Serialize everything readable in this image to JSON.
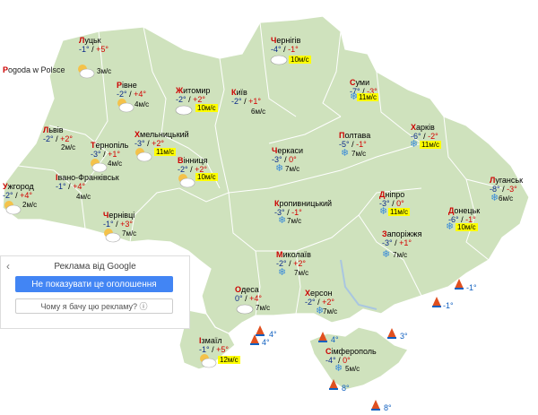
{
  "credit": {
    "first": "P",
    "rest": "ogoda w Polsce"
  },
  "cities": [
    {
      "id": "lutsk",
      "first": "Л",
      "rest": "уцьк",
      "tmin": "-1°",
      "tmax": "+5°",
      "wind": "3м/с",
      "hi": false
    },
    {
      "id": "rivne",
      "first": "Р",
      "rest": "івне",
      "tmin": "-2°",
      "tmax": "+4°",
      "wind": "4м/с",
      "hi": false
    },
    {
      "id": "zhytomyr",
      "first": "Ж",
      "rest": "итомир",
      "tmin": "-2°",
      "tmax": "+2°",
      "wind": "10м/с",
      "hi": true
    },
    {
      "id": "kyiv",
      "first": "К",
      "rest": "иїв",
      "tmin": "-2°",
      "tmax": "+1°",
      "wind": "6м/с",
      "hi": false
    },
    {
      "id": "chernihiv",
      "first": "Ч",
      "rest": "ернігів",
      "tmin": "-4°",
      "tmax": "-1°",
      "wind": "10м/с",
      "hi": true
    },
    {
      "id": "sumy",
      "first": "С",
      "rest": "уми",
      "tmin": "-7°",
      "tmax": "-3°",
      "wind": "11м/с",
      "hi": true
    },
    {
      "id": "lviv",
      "first": "Л",
      "rest": "ьвів",
      "tmin": "-2°",
      "tmax": "+2°",
      "wind": "2м/с",
      "hi": false
    },
    {
      "id": "ternopil",
      "first": "Т",
      "rest": "ернопіль",
      "tmin": "-3°",
      "tmax": "+1°",
      "wind": "4м/с",
      "hi": false
    },
    {
      "id": "khmelnytskyi",
      "first": "Х",
      "rest": "мельницький",
      "tmin": "-3°",
      "tmax": "+2°",
      "wind": "11м/с",
      "hi": true
    },
    {
      "id": "vinnytsia",
      "first": "В",
      "rest": "інниця",
      "tmin": "-2°",
      "tmax": "+2°",
      "wind": "10м/с",
      "hi": true
    },
    {
      "id": "cherkasy",
      "first": "Ч",
      "rest": "еркаси",
      "tmin": "-3°",
      "tmax": "0°",
      "wind": "7м/с",
      "hi": false
    },
    {
      "id": "poltava",
      "first": "П",
      "rest": "олтава",
      "tmin": "-5°",
      "tmax": "-1°",
      "wind": "7м/с",
      "hi": false
    },
    {
      "id": "kharkiv",
      "first": "Х",
      "rest": "арків",
      "tmin": "-6°",
      "tmax": "-2°",
      "wind": "11м/с",
      "hi": true
    },
    {
      "id": "uzhhorod",
      "first": "У",
      "rest": "жгород",
      "tmin": "-2°",
      "tmax": "+4°",
      "wind": "2м/с",
      "hi": false
    },
    {
      "id": "ivano-frankivsk",
      "first": "І",
      "rest": "вано-Франківськ",
      "tmin": "-1°",
      "tmax": "+4°",
      "wind": "4м/с",
      "hi": false
    },
    {
      "id": "chernivtsi",
      "first": "Ч",
      "rest": "ернівці",
      "tmin": "-1°",
      "tmax": "+3°",
      "wind": "7м/с",
      "hi": false
    },
    {
      "id": "kropyvnytskyi",
      "first": "К",
      "rest": "ропивницький",
      "tmin": "-3°",
      "tmax": "-1°",
      "wind": "7м/с",
      "hi": false
    },
    {
      "id": "dnipro",
      "first": "Д",
      "rest": "ніпро",
      "tmin": "-3°",
      "tmax": "0°",
      "wind": "11м/с",
      "hi": true
    },
    {
      "id": "luhansk",
      "first": "Л",
      "rest": "уганськ",
      "tmin": "-8°",
      "tmax": "-3°",
      "wind": "6м/с",
      "hi": false
    },
    {
      "id": "donetsk",
      "first": "Д",
      "rest": "онецьк",
      "tmin": "-6°",
      "tmax": "-1°",
      "wind": "10м/с",
      "hi": true
    },
    {
      "id": "zaporizhzhia",
      "first": "З",
      "rest": "апоріжжя",
      "tmin": "-3°",
      "tmax": "+1°",
      "wind": "7м/с",
      "hi": false
    },
    {
      "id": "mykolaiv",
      "first": "М",
      "rest": "иколаїв",
      "tmin": "-2°",
      "tmax": "+2°",
      "wind": "7м/с",
      "hi": false
    },
    {
      "id": "odesa",
      "first": "О",
      "rest": "деса",
      "tmin": "0°",
      "tmax": "+4°",
      "wind": "7м/с",
      "hi": false
    },
    {
      "id": "kherson",
      "first": "Х",
      "rest": "ерсон",
      "tmin": "-2°",
      "tmax": "+2°",
      "wind": "7м/с",
      "hi": false
    },
    {
      "id": "izmail",
      "first": "І",
      "rest": "змаїл",
      "tmin": "-1°",
      "tmax": "+5°",
      "wind": "12м/с",
      "hi": true
    },
    {
      "id": "simferopol",
      "first": "С",
      "rest": "імферополь",
      "tmin": "-4°",
      "tmax": "0°",
      "wind": "5м/с",
      "hi": false
    }
  ],
  "sea": [
    "-1°",
    "-1°",
    "4°",
    "4°",
    "4°",
    "3°",
    "8°",
    "8°"
  ],
  "ad": {
    "title": "Реклама від Google",
    "stop_button": "Не показувати це оголошення",
    "why_button": "Чому я бачу цю рекламу? ⓘ",
    "back": "‹"
  }
}
